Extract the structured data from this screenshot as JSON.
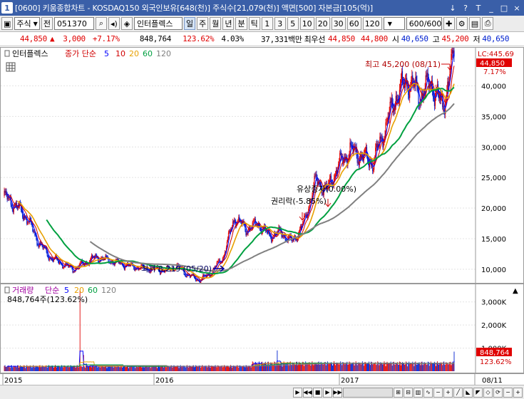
{
  "window": {
    "app_badge": "1",
    "title": "[0600] 키움종합차트 - KOSDAQ150 외국인보유[648(천)] 주식수[21,079(천)] 액면[500] 자본금[105(억)]",
    "buttons": [
      "↓",
      "?",
      "T",
      "_",
      "□",
      "×"
    ]
  },
  "toolbar": {
    "type_select": "주식",
    "prefix_label": "전",
    "code": "051370",
    "company_name": "인터플렉스",
    "periods": [
      "일",
      "주",
      "월",
      "년",
      "분",
      "틱"
    ],
    "active_period": "일",
    "intervals": [
      "1",
      "3",
      "5",
      "10",
      "20",
      "30",
      "60",
      "120"
    ],
    "count": "600",
    "total": "/600"
  },
  "pricebar": {
    "price": "44,850",
    "change": "3,000",
    "change_pct": "+7.17%",
    "volume": "848,764",
    "volume_ratio": "123.62%",
    "turnover": "4.03%",
    "amount": "37,331백만",
    "best_ask_label": "최우선",
    "ask": "44,850",
    "bid": "44,800",
    "open_label": "시",
    "open": "40,650",
    "high_label": "고",
    "high": "45,200",
    "low_label": "저",
    "low": "40,650"
  },
  "price_pane": {
    "legend_name": "인터플렉스",
    "legend_ma": "종가 단순",
    "ma_periods": [
      "5",
      "10",
      "20",
      "60",
      "120"
    ],
    "lc_label": "LC:445.69",
    "last_price_label": "44,850",
    "last_pct_label": "7.17%",
    "high_annotation": "최고 45,200 (08/11)",
    "low_annotation": "최저 8,219 (05/20)",
    "event_rights": "권리락(-5.85%)",
    "event_capital": "유상증자(0.00%)"
  },
  "volume_pane": {
    "legend_name": "거래량",
    "legend_ma": "단순",
    "ma_periods": [
      "5",
      "20",
      "60",
      "120"
    ],
    "current_label": "848,764주(123.62%)",
    "last_volume_label": "848,764",
    "last_pct_label": "123.62%"
  },
  "xaxis": {
    "last_date": "08/11"
  },
  "colors": {
    "up": "#e00000",
    "down": "#0020d0",
    "ma5": "#0000ff",
    "ma10": "#d00000",
    "ma20": "#e8a000",
    "ma60": "#00a040",
    "ma120": "#808080"
  },
  "chart_data": [
    {
      "type": "line",
      "title": "인터플렉스",
      "x": [
        "2015",
        "2016",
        "2017",
        "08/11"
      ],
      "ylim": [
        8000,
        46000
      ],
      "y_ticks": [
        "10,000",
        "15,000",
        "20,000",
        "25,000",
        "30,000",
        "35,000",
        "40,000"
      ],
      "series": [
        {
          "name": "종가",
          "values": [
            22000,
            20500,
            18500,
            14500,
            12000,
            11000,
            10000,
            11000,
            12000,
            11500,
            11000,
            10500,
            10200,
            10000,
            9800,
            10500,
            9000,
            8219,
            9500,
            12000,
            18500,
            16500,
            17500,
            15500,
            16000,
            14500,
            17500,
            24500,
            23000,
            27000,
            29500,
            28500,
            27500,
            33000,
            38500,
            41000,
            38500,
            40500,
            36500,
            44850
          ]
        }
      ]
    },
    {
      "type": "bar",
      "title": "거래량",
      "x": [
        "2015",
        "2016",
        "2017",
        "08/11"
      ],
      "y_ticks": [
        "1,000K",
        "2,000K",
        "3,000K"
      ],
      "ylim": [
        0,
        3700000
      ],
      "series": [
        {
          "name": "거래량",
          "values": [
            848764
          ]
        }
      ]
    }
  ]
}
